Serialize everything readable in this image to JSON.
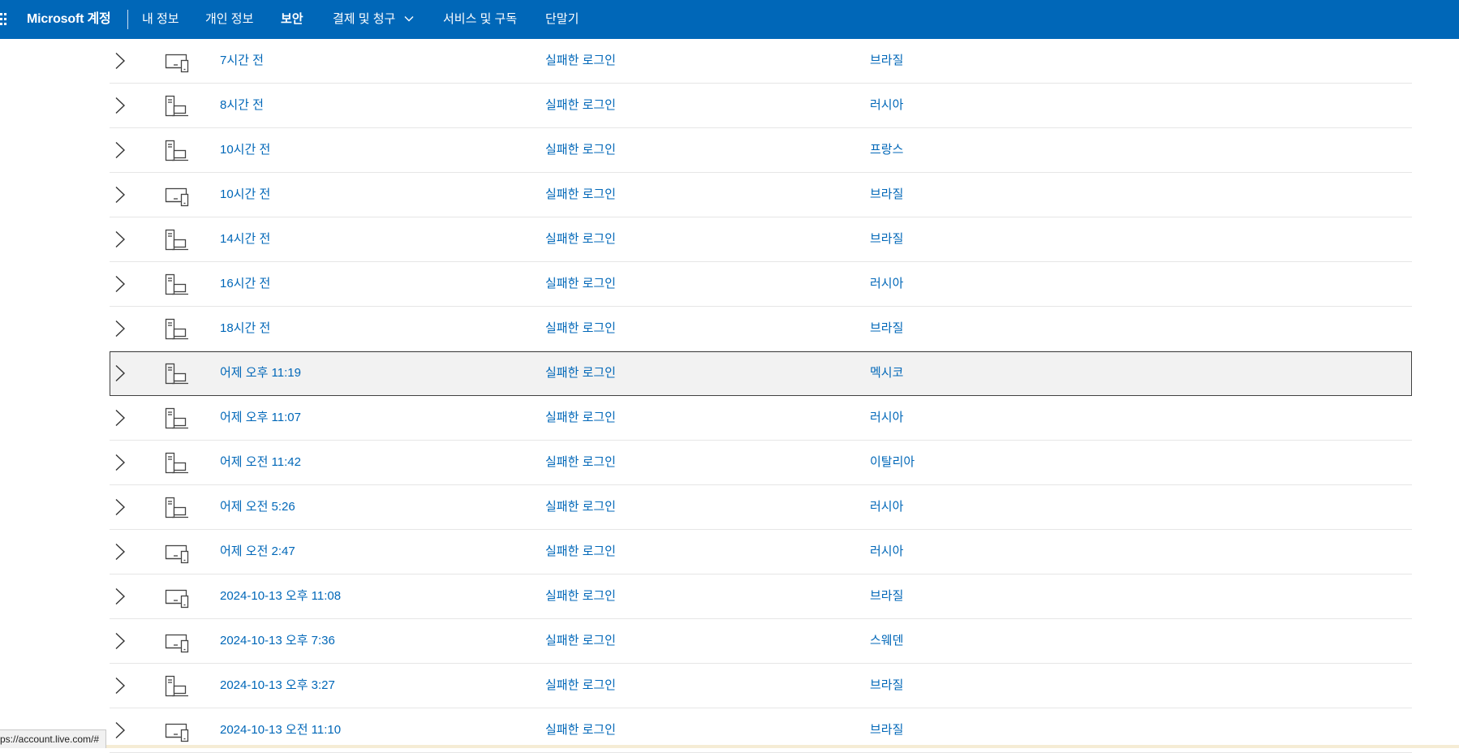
{
  "header": {
    "brand": "Microsoft 계정",
    "nav": [
      {
        "label": "내 정보",
        "active": false
      },
      {
        "label": "개인 정보",
        "active": false
      },
      {
        "label": "보안",
        "active": true
      },
      {
        "label": "결제 및 청구",
        "active": false,
        "has_dropdown": true
      },
      {
        "label": "서비스 및 구독",
        "active": false
      },
      {
        "label": "단말기",
        "active": false
      }
    ]
  },
  "activity": {
    "rows": [
      {
        "time": "7시간 전",
        "event": "실패한 로그인",
        "location": "브라질",
        "device_icon": "mobile-desktop-icon"
      },
      {
        "time": "8시간 전",
        "event": "실패한 로그인",
        "location": "러시아",
        "device_icon": "pc-laptop-icon"
      },
      {
        "time": "10시간 전",
        "event": "실패한 로그인",
        "location": "프랑스",
        "device_icon": "pc-laptop-icon"
      },
      {
        "time": "10시간 전",
        "event": "실패한 로그인",
        "location": "브라질",
        "device_icon": "mobile-desktop-icon"
      },
      {
        "time": "14시간 전",
        "event": "실패한 로그인",
        "location": "브라질",
        "device_icon": "pc-laptop-icon"
      },
      {
        "time": "16시간 전",
        "event": "실패한 로그인",
        "location": "러시아",
        "device_icon": "pc-laptop-icon"
      },
      {
        "time": "18시간 전",
        "event": "실패한 로그인",
        "location": "브라질",
        "device_icon": "pc-laptop-icon"
      },
      {
        "time": "어제 오후 11:19",
        "event": "실패한 로그인",
        "location": "멕시코",
        "device_icon": "pc-laptop-icon",
        "selected": true
      },
      {
        "time": "어제 오후 11:07",
        "event": "실패한 로그인",
        "location": "러시아",
        "device_icon": "pc-laptop-icon"
      },
      {
        "time": "어제 오전 11:42",
        "event": "실패한 로그인",
        "location": "이탈리아",
        "device_icon": "pc-laptop-icon"
      },
      {
        "time": "어제 오전 5:26",
        "event": "실패한 로그인",
        "location": "러시아",
        "device_icon": "pc-laptop-icon"
      },
      {
        "time": "어제 오전 2:47",
        "event": "실패한 로그인",
        "location": "러시아",
        "device_icon": "mobile-desktop-icon"
      },
      {
        "time": "2024-10-13 오후 11:08",
        "event": "실패한 로그인",
        "location": "브라질",
        "device_icon": "mobile-desktop-icon"
      },
      {
        "time": "2024-10-13 오후 7:36",
        "event": "실패한 로그인",
        "location": "스웨덴",
        "device_icon": "mobile-desktop-icon"
      },
      {
        "time": "2024-10-13 오후 3:27",
        "event": "실패한 로그인",
        "location": "브라질",
        "device_icon": "pc-laptop-icon"
      },
      {
        "time": "2024-10-13 오전 11:10",
        "event": "실패한 로그인",
        "location": "브라질",
        "device_icon": "mobile-desktop-icon"
      }
    ]
  },
  "status_bar": {
    "url": "ps://account.live.com/#"
  },
  "colors": {
    "header_bg": "#0067b8",
    "link": "#0067b8",
    "row_divider": "#e6e6e6",
    "selected_bg": "#f2f2f2"
  }
}
